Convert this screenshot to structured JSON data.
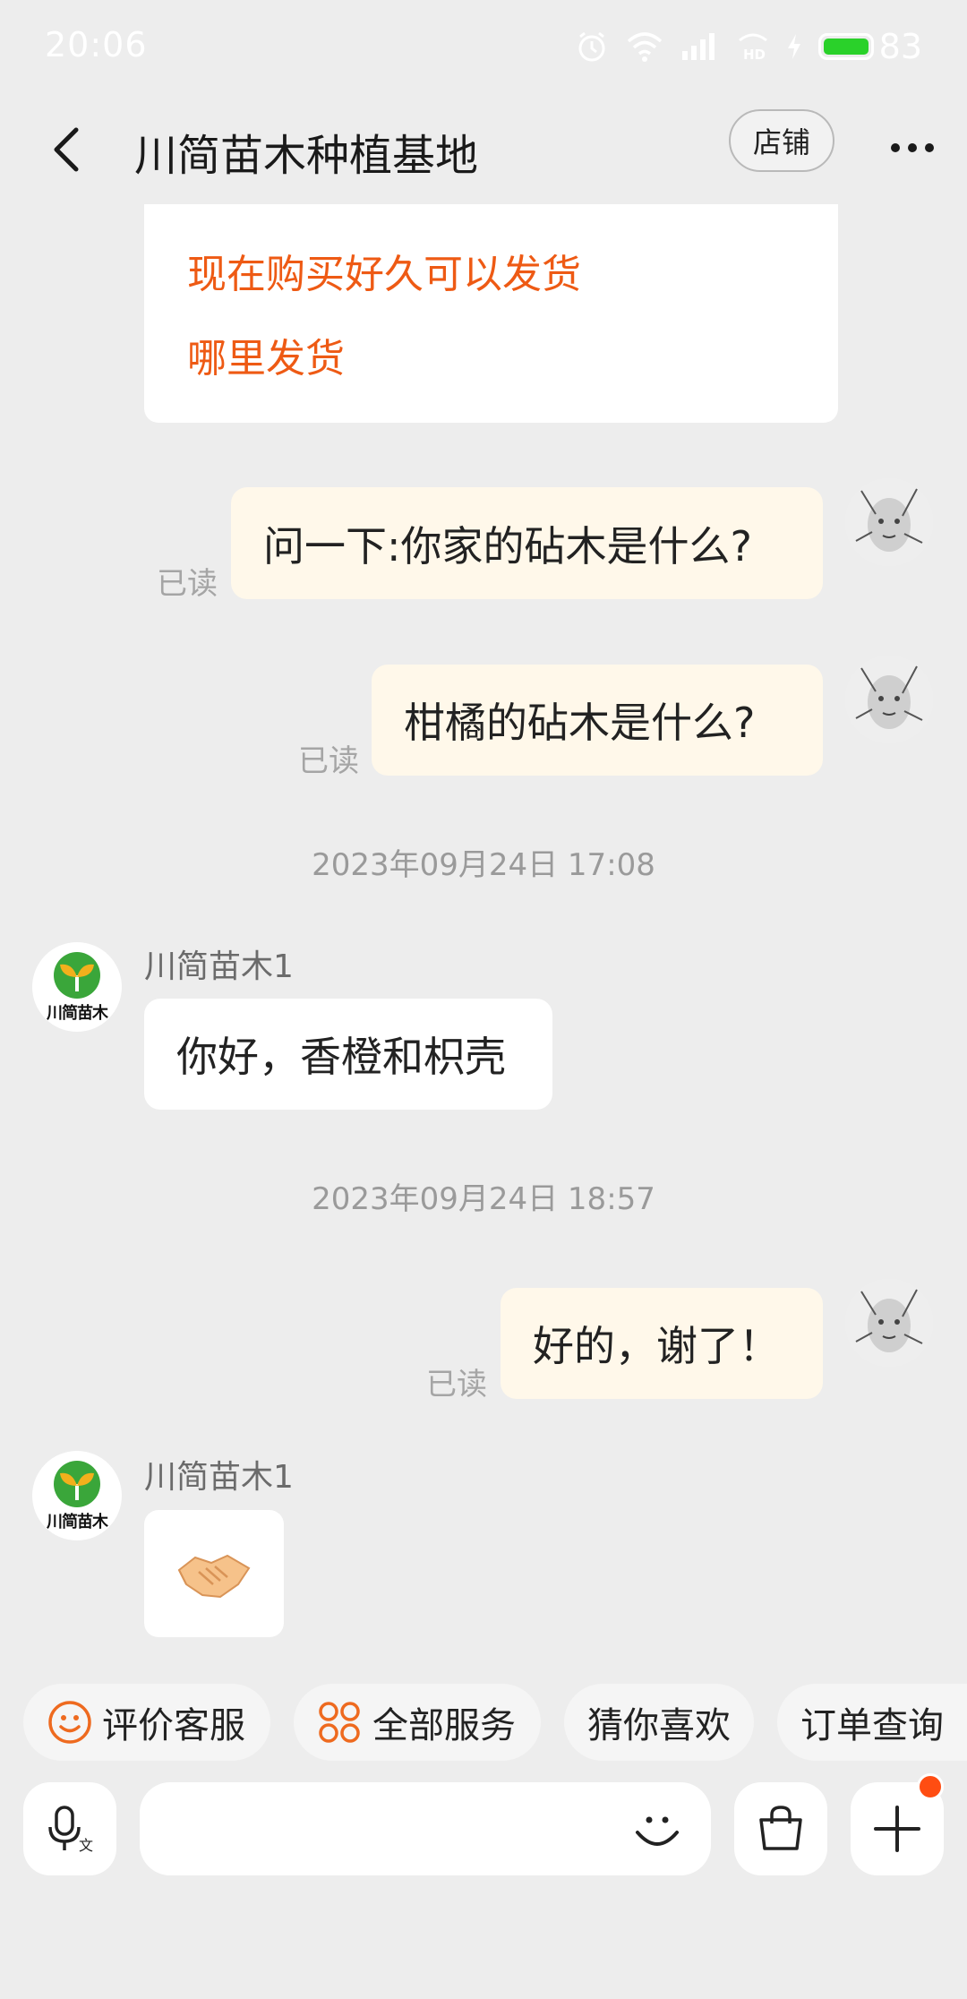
{
  "status_bar": {
    "time": "20:06",
    "battery_level": "83",
    "icons": [
      "alarm-icon",
      "wifi-icon",
      "signal-icon",
      "hd-icon",
      "charging-icon",
      "battery-icon"
    ]
  },
  "header": {
    "title": "川简苗木种植基地",
    "shop_label": "店铺",
    "back_icon": "chevron-left-icon",
    "more_icon": "more-dots-icon"
  },
  "messages": {
    "card_lines": [
      "现在购买好久可以发货",
      "哪里发货"
    ],
    "out_1": {
      "text": "问一下:你家的砧木是什么?",
      "read": "已读"
    },
    "out_2": {
      "text": "柑橘的砧木是什么?",
      "read": "已读"
    },
    "time_1": "2023年09月24日 17:08",
    "in_1": {
      "sender": "川简苗木1",
      "text": "你好，香橙和枳壳"
    },
    "time_2": "2023年09月24日 18:57",
    "out_3": {
      "text": "好的，谢了！",
      "read": "已读"
    },
    "in_2": {
      "sender": "川简苗木1",
      "emoji": "🤝"
    },
    "shop_logo_text": "川简苗木"
  },
  "quick_actions": [
    {
      "label": "评价客服",
      "icon": "smile-icon"
    },
    {
      "label": "全部服务",
      "icon": "grid-icon"
    },
    {
      "label": "猜你喜欢"
    },
    {
      "label": "订单查询"
    }
  ],
  "input_bar": {
    "placeholder": "",
    "icons": [
      "voice-translate-icon",
      "emoji-icon",
      "shopping-bag-icon",
      "plus-icon"
    ]
  },
  "colors": {
    "accent": "#ee5a14",
    "outgoing_bubble": "#fff8ea",
    "incoming_bubble": "#ffffff",
    "background": "#ededed",
    "notification_dot": "#ff4d12"
  }
}
